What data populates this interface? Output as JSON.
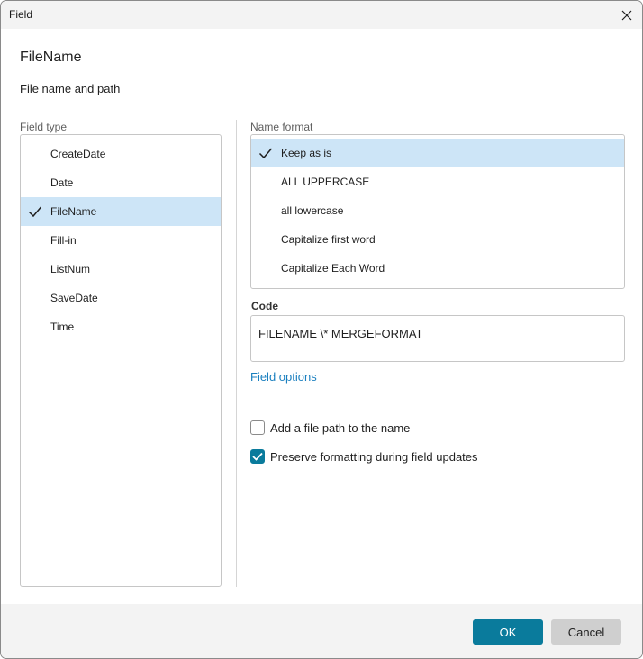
{
  "window": {
    "title": "Field"
  },
  "header": {
    "field_name": "FileName",
    "description": "File name and path"
  },
  "field_type": {
    "label": "Field type",
    "items": [
      {
        "label": "CreateDate",
        "selected": false
      },
      {
        "label": "Date",
        "selected": false
      },
      {
        "label": "FileName",
        "selected": true
      },
      {
        "label": "Fill-in",
        "selected": false
      },
      {
        "label": "ListNum",
        "selected": false
      },
      {
        "label": "SaveDate",
        "selected": false
      },
      {
        "label": "Time",
        "selected": false
      }
    ]
  },
  "name_format": {
    "label": "Name format",
    "items": [
      {
        "label": "Keep as is",
        "selected": true
      },
      {
        "label": "ALL UPPERCASE",
        "selected": false
      },
      {
        "label": "all lowercase",
        "selected": false
      },
      {
        "label": "Capitalize first word",
        "selected": false
      },
      {
        "label": "Capitalize Each Word",
        "selected": false
      }
    ]
  },
  "code": {
    "label": "Code",
    "value": "FILENAME \\* MERGEFORMAT"
  },
  "field_options": {
    "label": "Field options"
  },
  "options": {
    "add_path": {
      "label": "Add a file path to the name",
      "checked": false
    },
    "preserve_formatting": {
      "label": "Preserve formatting during field updates",
      "checked": true
    }
  },
  "buttons": {
    "ok": "OK",
    "cancel": "Cancel"
  },
  "colors": {
    "accent": "#0a7b9c",
    "selection": "#cde5f7",
    "link": "#1a7fbf"
  }
}
